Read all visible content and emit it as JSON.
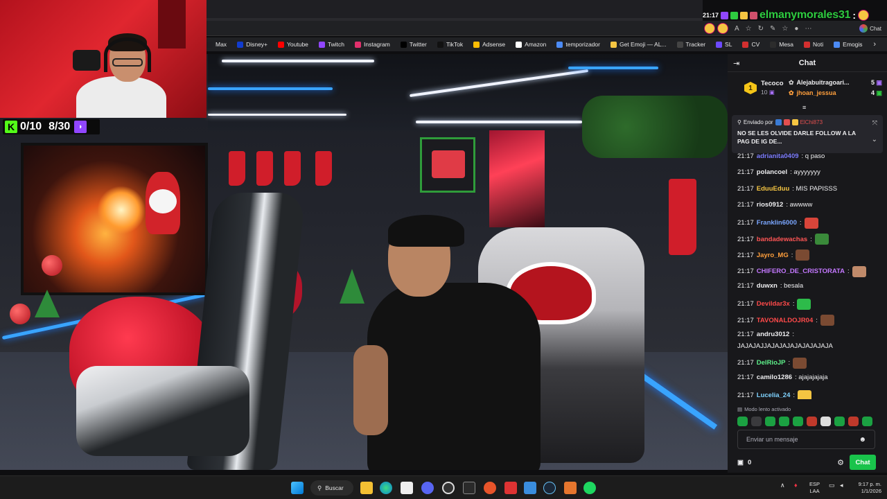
{
  "overlay": {
    "time": "21:17",
    "username": "elmanymorales31",
    "colon": ":",
    "counter": {
      "kick": "0/10",
      "twitch": "8/30"
    }
  },
  "browser": {
    "chat_pill": "Chat",
    "bookmarks": [
      {
        "label": "Max",
        "icon": "max-icon",
        "color": "#1f1f23"
      },
      {
        "label": "Disney+",
        "icon": "disney-icon",
        "color": "#113ccf"
      },
      {
        "label": "Youtube",
        "icon": "youtube-icon",
        "color": "#ff0000"
      },
      {
        "label": "Twitch",
        "icon": "twitch-icon",
        "color": "#9146ff"
      },
      {
        "label": "Instagram",
        "icon": "instagram-icon",
        "color": "#e1306c"
      },
      {
        "label": "Twitter",
        "icon": "x-icon",
        "color": "#000000"
      },
      {
        "label": "TikTok",
        "icon": "tiktok-icon",
        "color": "#111111"
      },
      {
        "label": "Adsense",
        "icon": "adsense-icon",
        "color": "#fbbc04"
      },
      {
        "label": "Amazon",
        "icon": "amazon-icon",
        "color": "#ffffff"
      },
      {
        "label": "temporizador",
        "icon": "timer-icon",
        "color": "#4c8bf5"
      },
      {
        "label": "Get Emoji — AL...",
        "icon": "emoji-icon",
        "color": "#f4c542"
      },
      {
        "label": "Tracker",
        "icon": "tracker-icon",
        "color": "#444444"
      },
      {
        "label": "SL",
        "icon": "sl-icon",
        "color": "#6d4aff"
      },
      {
        "label": "CV",
        "icon": "cv-icon",
        "color": "#d32f2f"
      },
      {
        "label": "Mesa",
        "icon": "mesa-icon",
        "color": "#2c2c2c"
      },
      {
        "label": "Noti",
        "icon": "noti-icon",
        "color": "#d32f2f"
      },
      {
        "label": "Emogis",
        "icon": "emogis-icon",
        "color": "#4c8bf5"
      }
    ]
  },
  "chat": {
    "header": "Chat",
    "leaderboard": {
      "top": {
        "rank": "1",
        "name": "Tecoco",
        "count": "10"
      },
      "rows": [
        {
          "name": "Alejabuitragoari...",
          "count": "5",
          "color": "#efeff1"
        },
        {
          "name": "jhoan_jessua",
          "count": "4",
          "color": "#ff9f3c"
        }
      ]
    },
    "pinned": {
      "sent_by": "Enviado por",
      "user": "ElChi873",
      "message": "NO SE LES OLVIDE DARLE FOLLOW A LA PAG DE IG DE..."
    },
    "messages": [
      {
        "time": "21:17",
        "user": "adrianita0409",
        "text": ": q paso",
        "color": "#7d7dff",
        "emote": ""
      },
      {
        "time": "21:17",
        "user": "polancoel",
        "text": ": ayyyyyyy",
        "color": "#efeff1",
        "emote": ""
      },
      {
        "time": "21:17",
        "user": "EduuEduu",
        "text": ": MIS PAPISSS",
        "color": "#f5c542",
        "emote": ""
      },
      {
        "time": "21:17",
        "user": "rios0912",
        "text": ": awwww",
        "color": "#efeff1",
        "emote": ""
      },
      {
        "time": "21:17",
        "user": "Franklin6000",
        "text": ":",
        "color": "#7aa6ff",
        "emote": "#d8453a"
      },
      {
        "time": "21:17",
        "user": "bandadewachas",
        "text": ":",
        "color": "#ff5555",
        "emote": "#3a8a3a"
      },
      {
        "time": "21:17",
        "user": "Jayro_MG",
        "text": ":",
        "color": "#ff9f3c",
        "emote": "#7a4a32"
      },
      {
        "time": "21:17",
        "user": "CHIFERO_DE_CRISTORATA",
        "text": ":",
        "color": "#c478ff",
        "emote": "#c08a6a"
      },
      {
        "time": "21:17",
        "user": "duwxn",
        "text": ": besala",
        "color": "#efeff1",
        "emote": ""
      },
      {
        "time": "21:17",
        "user": "Devildar3x",
        "text": ":",
        "color": "#ff4a4a",
        "emote": "#2dbb4a"
      },
      {
        "time": "21:17",
        "user": "TAVONALDOJR04",
        "text": ":",
        "color": "#ff4a4a",
        "emote": "#7a4a32"
      },
      {
        "time": "21:17",
        "user": "andru3012",
        "text": ":",
        "color": "#efeff1",
        "emote": ""
      },
      {
        "time": "21:17",
        "user": "DelRioJP",
        "text": ":",
        "color": "#5ef08a",
        "emote": "#7a4a32"
      },
      {
        "time": "21:17",
        "user": "camilo1286",
        "text": ": ajajajajaja",
        "color": "#efeff1",
        "emote": ""
      },
      {
        "time": "21:17",
        "user": "Lucelia_24",
        "text": ":",
        "color": "#7fd3ff",
        "emote": "#f4c542"
      }
    ],
    "andru_text": "JAJAJAJJAJAJAJAJAJAJAJAJA",
    "slow_mode": "Modo lento activado",
    "input_placeholder": "Enviar un mensaje",
    "points": "0",
    "send_button": "Chat"
  },
  "taskbar": {
    "search": "Buscar",
    "lang": "ESP",
    "lang2": "LAA",
    "time": "9:17 p. m.",
    "date": "1/1/2026"
  },
  "colors": {
    "twitch_purple": "#9146ff",
    "kick_green": "#53fc18",
    "chat_bg": "#18181b",
    "send_button": "#19c34b"
  }
}
